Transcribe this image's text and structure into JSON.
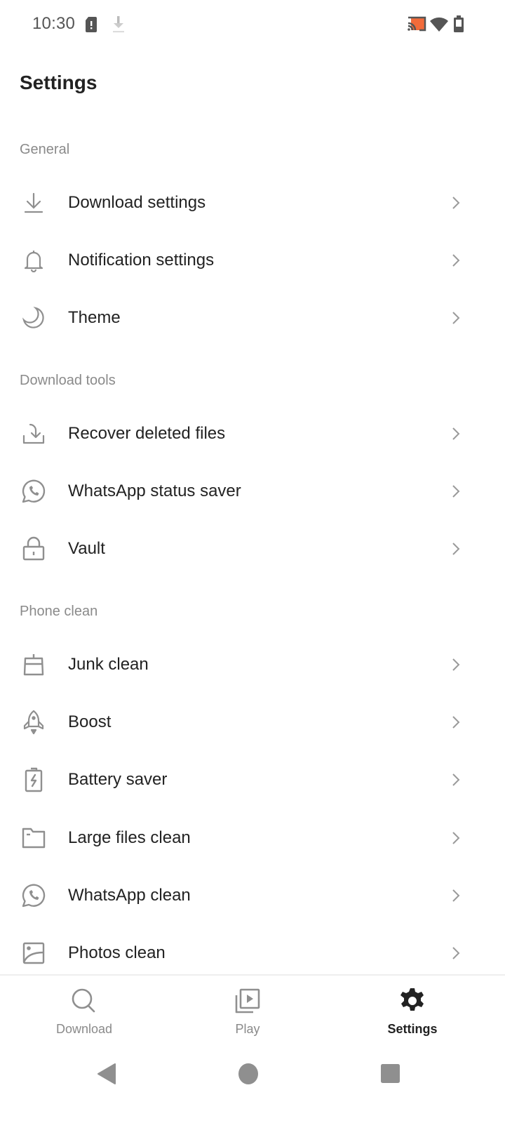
{
  "status_bar": {
    "time": "10:30",
    "icons": [
      "sim-alert-icon",
      "download-icon",
      "cast-icon",
      "wifi-icon",
      "battery-icon"
    ],
    "cast_accent": "#f26b3a"
  },
  "header": {
    "title": "Settings"
  },
  "sections": [
    {
      "title": "General",
      "items": [
        {
          "label": "Download settings",
          "icon": "download-icon"
        },
        {
          "label": "Notification settings",
          "icon": "bell-icon"
        },
        {
          "label": "Theme",
          "icon": "moon-icon"
        }
      ]
    },
    {
      "title": "Download tools",
      "items": [
        {
          "label": "Recover deleted files",
          "icon": "recover-icon"
        },
        {
          "label": "WhatsApp status saver",
          "icon": "whatsapp-icon"
        },
        {
          "label": "Vault",
          "icon": "lock-icon"
        }
      ]
    },
    {
      "title": "Phone clean",
      "items": [
        {
          "label": "Junk clean",
          "icon": "broom-icon"
        },
        {
          "label": "Boost",
          "icon": "rocket-icon"
        },
        {
          "label": "Battery saver",
          "icon": "battery-charge-icon"
        },
        {
          "label": "Large files clean",
          "icon": "folder-icon"
        },
        {
          "label": "WhatsApp clean",
          "icon": "whatsapp-icon"
        },
        {
          "label": "Photos clean",
          "icon": "image-icon"
        }
      ]
    }
  ],
  "bottom_nav": {
    "tabs": [
      {
        "label": "Download",
        "icon": "search-icon",
        "active": false
      },
      {
        "label": "Play",
        "icon": "play-library-icon",
        "active": false
      },
      {
        "label": "Settings",
        "icon": "gear-icon",
        "active": true
      }
    ]
  },
  "system_nav": {
    "buttons": [
      "back",
      "home",
      "recents"
    ]
  },
  "colors": {
    "icon_gray": "#8f8f8f",
    "text_dark": "#222222",
    "section_gray": "#8a8a8a",
    "active": "#222222"
  }
}
